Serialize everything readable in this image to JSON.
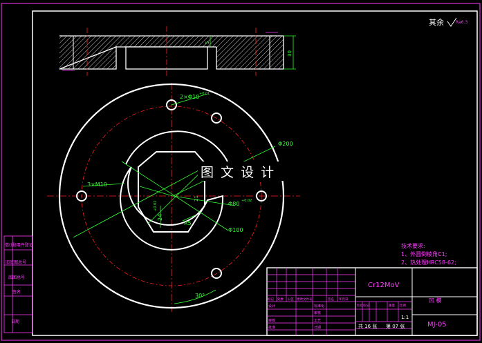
{
  "surface_finish": "其余",
  "surface_finish_value": "Ra6.3",
  "side_view": {
    "depth_dim": "5",
    "height_dim": "30"
  },
  "plan_view": {
    "hole_callout": "2×Φ10",
    "hole_callout_tol": "+0.01",
    "tapped_holes": "3×M10",
    "dim_outer": "Φ200",
    "dim_inner_bore": "Φ80",
    "dim_inner_bore_tol": "+0.02",
    "dim_pcd": "Φ100",
    "dim_r5": "R5",
    "dim_24": "24",
    "dim_24_tol": "+0.02",
    "dim_angle": "30°",
    "dim_21": "21"
  },
  "watermark": "图 文 设 计",
  "tech_requirements": {
    "title": "技术要求:",
    "item1": "1、外圆倒棱角C1;",
    "item2": "2、热处理HRC58-62;"
  },
  "side_stamps": [
    "借(通)用件登记",
    "旧底图总号",
    "底图总号",
    "签名",
    "日期"
  ],
  "title_block": {
    "material": "Cr12MoV",
    "part_name": "凹  模",
    "drawing_no": "MJ-05",
    "scale": "1:1",
    "sheet_total": "共 16 张",
    "sheet_no": "第 07 张",
    "headers": [
      "标记",
      "处数",
      "分区",
      "更改文件号",
      "签名",
      "年月日"
    ],
    "row_design": [
      "设计",
      "标准化"
    ],
    "row_check": [
      "审核",
      "工艺"
    ],
    "row_approve": [
      "批准",
      "日期"
    ],
    "stage_cols": [
      "阶段标记",
      "重量",
      "比例"
    ]
  },
  "colors": {
    "frame": "#ff3cff",
    "part_outline": "#ffffff",
    "center_line": "#ff2020",
    "dimension": "#33ff33",
    "hatch": "#ffffff"
  }
}
